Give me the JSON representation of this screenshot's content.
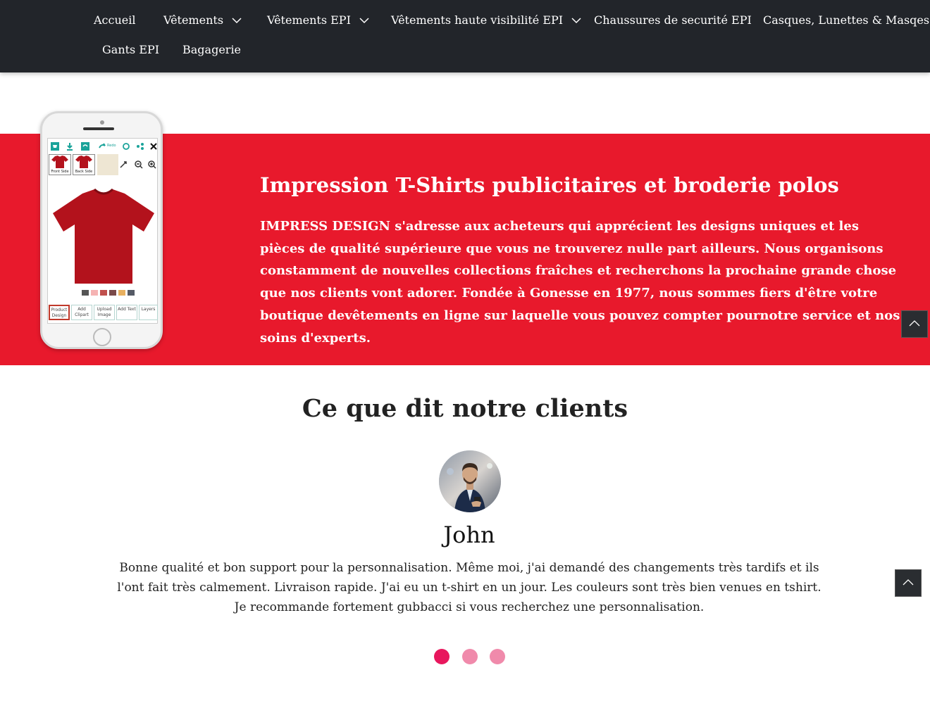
{
  "nav": {
    "items": [
      {
        "label": "Accueil",
        "dropdown": false
      },
      {
        "label": "Vêtements",
        "dropdown": true
      },
      {
        "label": "Vêtements EPI",
        "dropdown": true
      },
      {
        "label": "Vêtements haute visibilité EPI",
        "dropdown": true
      },
      {
        "label": "Chaussures de securité EPI",
        "dropdown": false
      },
      {
        "label": "Casques, Lunettes & Masqes EPI",
        "dropdown": false
      },
      {
        "label": "Gants EPI",
        "dropdown": false
      },
      {
        "label": "Bagagerie",
        "dropdown": false
      }
    ]
  },
  "banner": {
    "title": "Impression T-Shirts publicitaires et broderie polos",
    "text": "IMPRESS DESIGN s'adresse aux acheteurs qui apprécient les designs uniques et les pièces de qualité supérieure que vous ne trouverez nulle part ailleurs. Nous organisons constamment de nouvelles collections fraîches et recherchons la prochaine grande chose que nos clients vont adorer. Fondée à Gonesse en 1977, nous sommes fiers d'être votre boutique devêtements en ligne sur laquelle vous pouvez compter pournotre service et nos soins d'experts.",
    "background": "#e8192c",
    "phone": {
      "toolbar_redo": "Redo",
      "front_label": "Front Side",
      "back_label": "Back Side",
      "bottom_buttons": [
        "Product Design",
        "Add Clipart",
        "Upload Image",
        "Add Text",
        "Layers"
      ],
      "swatch_colors": [
        "#555555",
        "#f5b3b3",
        "#c0504d",
        "#7a4a4a",
        "#e8b060",
        "#555a66"
      ]
    }
  },
  "testimonials": {
    "title": "Ce que dit notre clients",
    "client_name": "John",
    "review": "Bonne qualité et bon support pour la personnalisation. Même moi, j'ai demandé des changements très tardifs et ils l'ont fait très calmement. Livraison rapide. J'ai eu un t-shirt en un jour. Les couleurs sont très bien venues en tshirt. Je recommande fortement gubbacci si vous recherchez une personnalisation.",
    "dots": {
      "count": 3,
      "active_index": 0,
      "active_color": "#e8175d",
      "inactive_color": "#f08aab"
    }
  },
  "colors": {
    "nav_bg": "#22252a",
    "accent_red": "#e8192c",
    "shirt_red": "#b3121c",
    "teal": "#1aa39a"
  }
}
